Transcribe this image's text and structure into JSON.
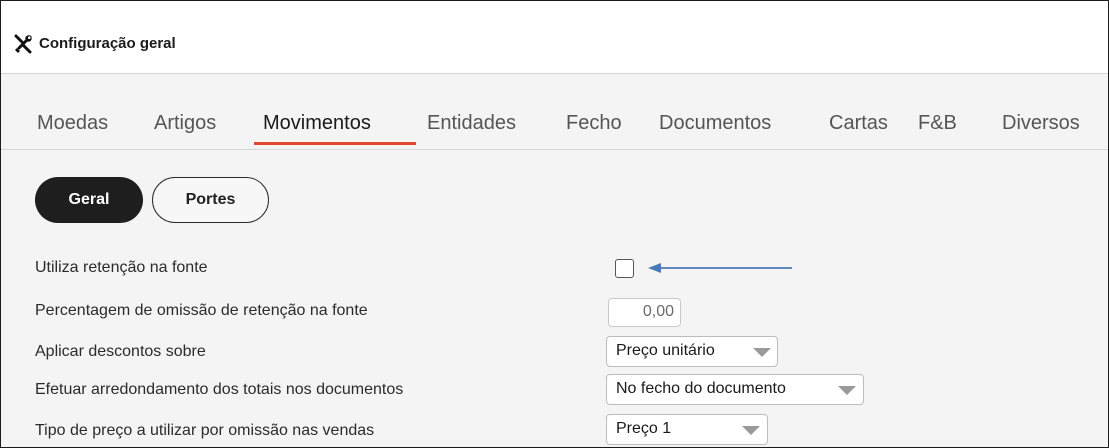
{
  "window": {
    "title": "Configuração geral",
    "icon": "tools-icon"
  },
  "tabs": [
    {
      "label": "Moedas",
      "active": false
    },
    {
      "label": "Artigos",
      "active": false
    },
    {
      "label": "Movimentos",
      "active": true
    },
    {
      "label": "Entidades",
      "active": false
    },
    {
      "label": "Fecho",
      "active": false
    },
    {
      "label": "Documentos",
      "active": false
    },
    {
      "label": "Cartas",
      "active": false
    },
    {
      "label": "F&B",
      "active": false
    },
    {
      "label": "Diversos",
      "active": false
    }
  ],
  "subtabs": [
    {
      "label": "Geral",
      "active": true
    },
    {
      "label": "Portes",
      "active": false
    }
  ],
  "settings": {
    "withholding": {
      "label": "Utiliza retenção na fonte",
      "checked": false
    },
    "omission_pct": {
      "label": "Percentagem de omissão de retenção na fonte",
      "value": "0,00"
    },
    "discounts": {
      "label": "Aplicar descontos sobre",
      "value": "Preço unitário"
    },
    "rounding": {
      "label": "Efetuar arredondamento dos totais nos documentos",
      "value": "No fecho do documento"
    },
    "price_type": {
      "label": "Tipo de preço a utilizar por omissão nas vendas",
      "value": "Preço 1"
    }
  },
  "colors": {
    "active_tab_underline": "#e0492e",
    "annotation_arrow": "#4a7ab5",
    "pill_active_bg": "#1e1e1e"
  }
}
